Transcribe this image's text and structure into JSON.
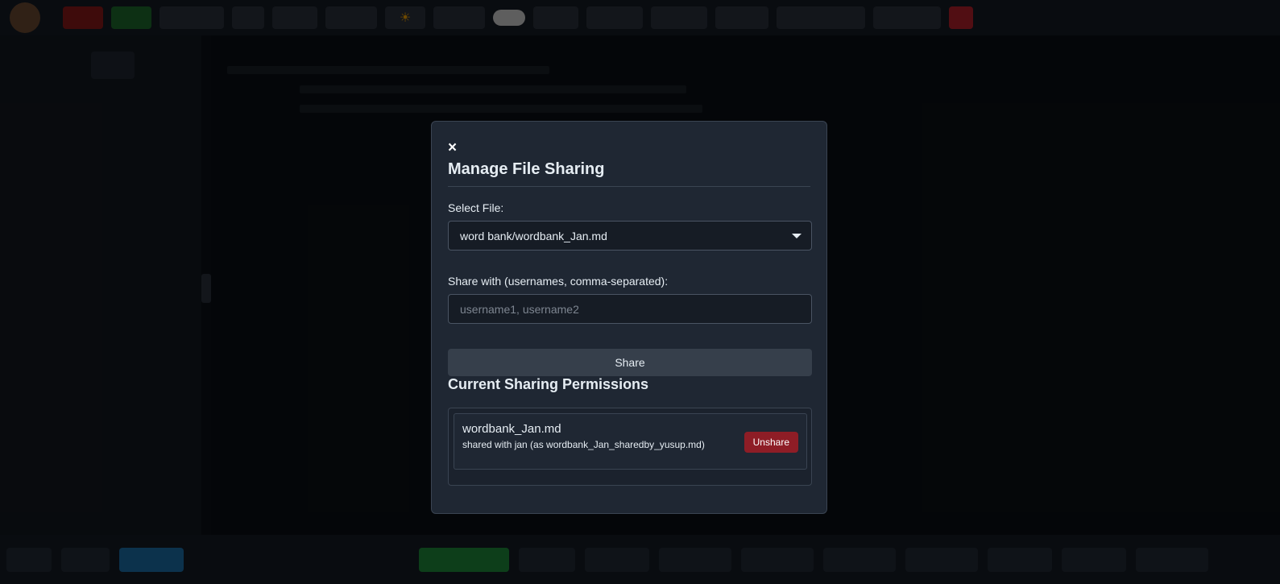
{
  "modal": {
    "close_label": "×",
    "title": "Manage File Sharing",
    "select_label": "Select File:",
    "selected_file": "word bank/wordbank_Jan.md",
    "share_with_label": "Share with (usernames, comma-separated):",
    "share_with_placeholder": "username1, username2",
    "share_with_value": "",
    "share_button": "Share",
    "permissions_title": "Current Sharing Permissions",
    "permissions": [
      {
        "file": "wordbank_Jan.md",
        "description": "shared with jan (as wordbank_Jan_sharedby_yusup.md)",
        "unshare_label": "Unshare"
      }
    ]
  },
  "colors": {
    "modal_bg": "#1f2733",
    "unshare": "#8e1d26",
    "share_button": "#363f4b",
    "overlay": "rgba(0,0,0,0.55)"
  },
  "icons": {
    "close": "close-icon",
    "select_caret": "chevron-down-icon",
    "theme": "sun-icon"
  }
}
